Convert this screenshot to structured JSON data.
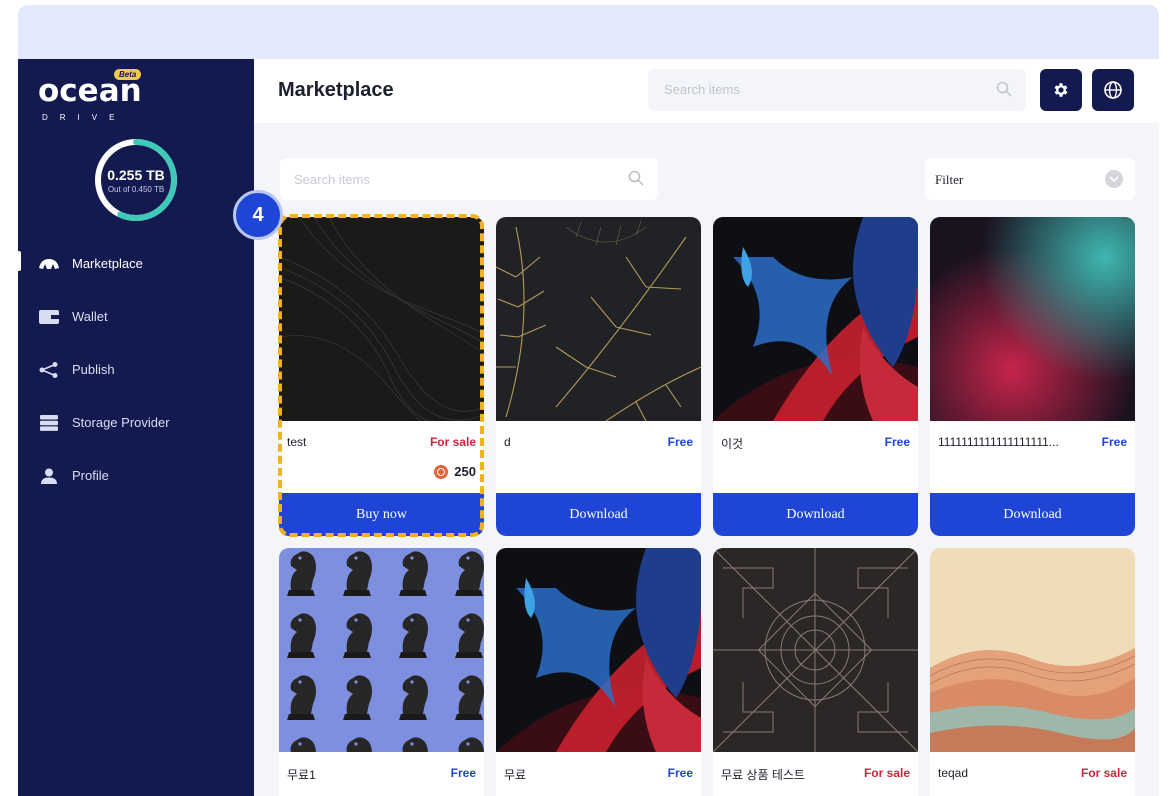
{
  "app": {
    "logo_text": "ocean",
    "logo_sub": "DRIVE",
    "logo_badge": "Beta"
  },
  "storage": {
    "used": "0.255 TB",
    "total": "Out of 0.450 TB",
    "used_fraction": 0.567
  },
  "sidebar": {
    "items": [
      {
        "label": "Marketplace",
        "icon": "marketplace-icon",
        "active": true
      },
      {
        "label": "Wallet",
        "icon": "wallet-icon"
      },
      {
        "label": "Publish",
        "icon": "share-icon"
      },
      {
        "label": "Storage Provider",
        "icon": "server-icon"
      },
      {
        "label": "Profile",
        "icon": "user-icon"
      }
    ]
  },
  "header": {
    "title": "Marketplace",
    "search_placeholder": "Search items",
    "settings_icon": "gear-icon",
    "language_icon": "globe-icon"
  },
  "main": {
    "search_placeholder": "Search items",
    "filter_label": "Filter"
  },
  "cards": [
    {
      "name": "test",
      "status": "For sale",
      "price": "250",
      "button": "Buy now"
    },
    {
      "name": "d",
      "status": "Free",
      "button": "Download"
    },
    {
      "name": "이것",
      "status": "Free",
      "button": "Download"
    },
    {
      "name": "1111111111111111111...",
      "status": "Free",
      "button": "Download"
    },
    {
      "name": "무료1",
      "status": "Free"
    },
    {
      "name": "무료",
      "status": "Free"
    },
    {
      "name": "무료 상품 테스트",
      "status": "For sale"
    },
    {
      "name": "teqad",
      "status": "For sale"
    }
  ],
  "annotation": {
    "step": "4"
  },
  "colors": {
    "sidebar_bg": "#131a4f",
    "accent": "#1f45d6",
    "sale": "#d2233c",
    "highlight": "#f2b21d"
  }
}
